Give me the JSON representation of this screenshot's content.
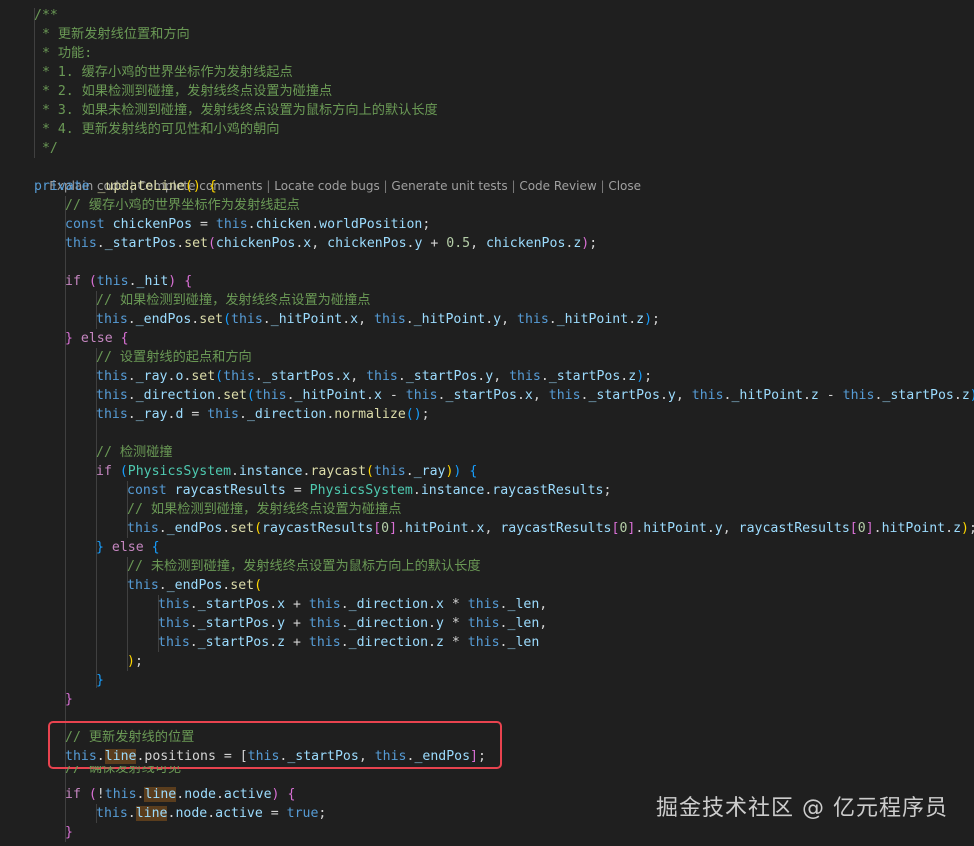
{
  "editor": {
    "doc_comment": [
      "/**",
      " * 更新发射线位置和方向",
      " * 功能:",
      " * 1. 缓存小鸡的世界坐标作为发射线起点",
      " * 2. 如果检测到碰撞，发射线终点设置为碰撞点",
      " * 3. 如果未检测到碰撞，发射线终点设置为鼠标方向上的默认长度",
      " * 4. 更新发射线的可见性和小鸡的朝向",
      " */"
    ],
    "codelens": {
      "explain": "Explain code",
      "complete_comments": "Complete comments",
      "locate_bugs": "Locate code bugs",
      "unit_tests": "Generate unit tests",
      "code_review": "Code Review",
      "close": "Close",
      "separator": " | "
    },
    "code": {
      "private_kw": "private",
      "method_name": "_updateLine",
      "comment_cache_pos": "// 缓存小鸡的世界坐标作为发射线起点",
      "comment_hit_end": "// 如果检测到碰撞，发射线终点设置为碰撞点",
      "comment_set_ray": "// 设置射线的起点和方向",
      "comment_detect": "// 检测碰撞",
      "comment_hit_end2": "// 如果检测到碰撞，发射线终点设置为碰撞点",
      "comment_miss_end": "// 未检测到碰撞，发射线终点设置为鼠标方向上的默认长度",
      "comment_update_pos": "// 更新发射线的位置",
      "comment_ensure_visible": "// 确保发射线可见",
      "positions_stmt": ".positions = [",
      "half": "0.5",
      "true_kw": "true"
    },
    "watermark": "掘金技术社区 @ 亿元程序员",
    "colors": {
      "background": "#1f1f1f",
      "comment": "#6a9955",
      "keyword": "#569cd6",
      "variable": "#9cdcfe",
      "function": "#dcdcaa",
      "class": "#4ec9b0",
      "highlight_border": "#e8434f"
    }
  }
}
